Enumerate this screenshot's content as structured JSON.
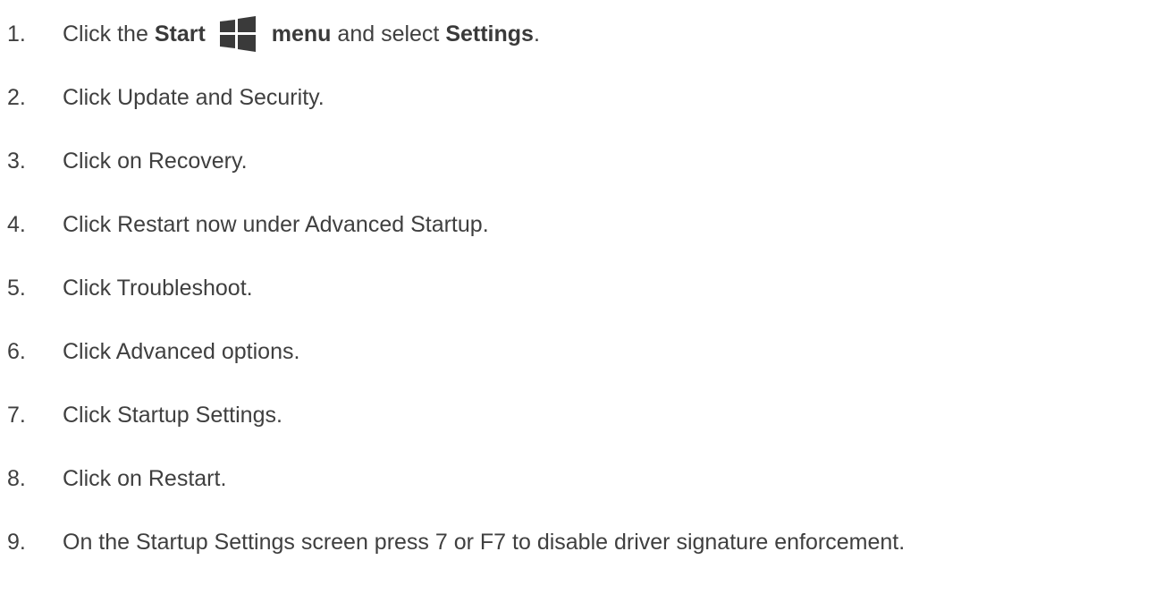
{
  "colors": {
    "text": "#3f3f3f",
    "icon": "#3a3a3a"
  },
  "icons": {
    "start": "windows-logo-icon"
  },
  "steps": [
    {
      "number": "1.",
      "parts": {
        "a": "Click the ",
        "b": "Start",
        "c": "menu",
        "d": " and select ",
        "e": "Settings",
        "f": "."
      }
    },
    {
      "number": "2.",
      "text": "Click Update and Security."
    },
    {
      "number": "3.",
      "text": "Click on Recovery."
    },
    {
      "number": "4.",
      "text": "Click Restart now under Advanced Startup."
    },
    {
      "number": "5.",
      "text": "Click Troubleshoot."
    },
    {
      "number": "6.",
      "text": "Click Advanced options."
    },
    {
      "number": "7.",
      "text": "Click Startup Settings."
    },
    {
      "number": "8.",
      "text": "Click on Restart."
    },
    {
      "number": "9.",
      "text": "On the Startup Settings screen press 7 or F7 to disable driver signature enforcement."
    }
  ]
}
